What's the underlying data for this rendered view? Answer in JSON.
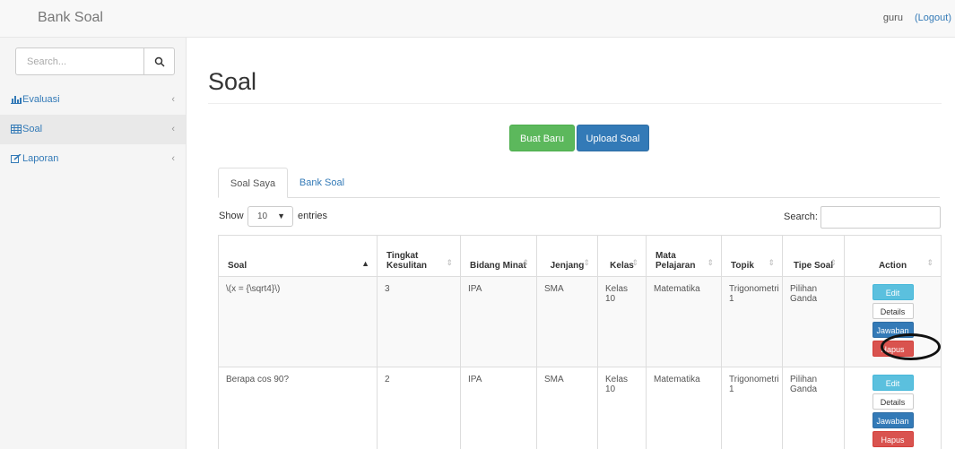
{
  "navbar": {
    "brand": "Bank Soal",
    "user": "guru",
    "logout": "(Logout)"
  },
  "sidebar": {
    "search_placeholder": "Search...",
    "items": [
      {
        "label": "Evaluasi",
        "icon": "bar-chart-icon"
      },
      {
        "label": "Soal",
        "icon": "table-icon"
      },
      {
        "label": "Laporan",
        "icon": "edit-icon"
      }
    ]
  },
  "page": {
    "title": "Soal",
    "btn_new": "Buat Baru",
    "btn_upload": "Upload Soal"
  },
  "tabs": [
    "Soal Saya",
    "Bank Soal"
  ],
  "controls": {
    "show": "Show",
    "entries_value": "10",
    "entries": "entries",
    "search": "Search:"
  },
  "table": {
    "headers": [
      "Soal",
      "Tingkat Kesulitan",
      "Bidang Minat",
      "Jenjang",
      "Kelas",
      "Mata Pelajaran",
      "Topik",
      "Tipe Soal",
      "Action"
    ],
    "rows": [
      {
        "soal": "\\(x = {\\sqrt4}\\)",
        "tingkat": "3",
        "bidang": "IPA",
        "jenjang": "SMA",
        "kelas": "Kelas 10",
        "mapel": "Matematika",
        "topik": "Trigonometri 1",
        "tipe": "Pilihan Ganda"
      },
      {
        "soal": "Berapa cos 90?",
        "tingkat": "2",
        "bidang": "IPA",
        "jenjang": "SMA",
        "kelas": "Kelas 10",
        "mapel": "Matematika",
        "topik": "Trigonometri 1",
        "tipe": "Pilihan Ganda"
      }
    ],
    "actions": {
      "edit": "Edit",
      "details": "Details",
      "jawaban": "Jawaban",
      "hapus": "Hapus"
    }
  }
}
